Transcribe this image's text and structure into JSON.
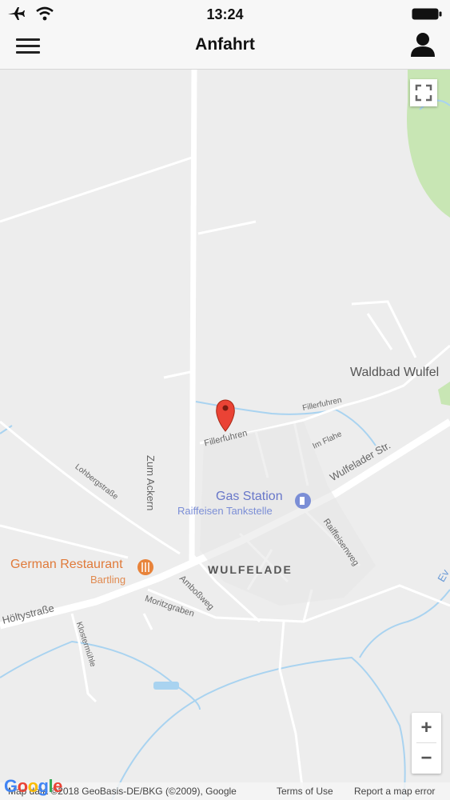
{
  "status_bar": {
    "time": "13:24",
    "airplane_icon": "airplane-icon",
    "wifi_icon": "wifi-icon",
    "battery_icon": "battery-icon"
  },
  "nav": {
    "title": "Anfahrt",
    "menu_icon": "hamburger-menu-icon",
    "user_icon": "user-profile-icon"
  },
  "map": {
    "place_labels": {
      "waldbad": "Waldbad Wulfel",
      "gas_station": "Gas Station",
      "raiffeisen": "Raiffeisen Tankstelle",
      "german_restaurant": "German Restaurant",
      "bartling": "Bartling",
      "wulfelade": "WULFELADE"
    },
    "street_labels": {
      "zum_ackern": "Zum Ackern",
      "fillerfuhren_upper": "Fillerfuhren",
      "fillerfuhren_lower": "Fillerfuhren",
      "im_flahe": "Im Flahe",
      "wulfelader_str": "Wulfelader Str.",
      "lohbergstrasse": "Lohbergstraße",
      "raiffeisenweg": "Raiffeisenweg",
      "ambossweg": "Amboßweg",
      "moritzgraben": "Moritzgraben",
      "hoeltystrasse": "Höltystraße",
      "klostermuehle": "Klostermühle",
      "edge_label": "Ev"
    },
    "controls": {
      "zoom_in": "+",
      "zoom_out": "−",
      "fullscreen_icon": "fullscreen-icon"
    },
    "colors": {
      "water": "#a9d3f0",
      "park": "#c8e6b4",
      "marker": "#e74c3c",
      "poi_orange": "#e8833a",
      "poi_blue": "#7b8ed6"
    }
  },
  "footer": {
    "logo": "Google",
    "attribution": "Map data ©2018 GeoBasis-DE/BKG (©2009), Google",
    "terms": "Terms of Use",
    "report": "Report a map error"
  }
}
